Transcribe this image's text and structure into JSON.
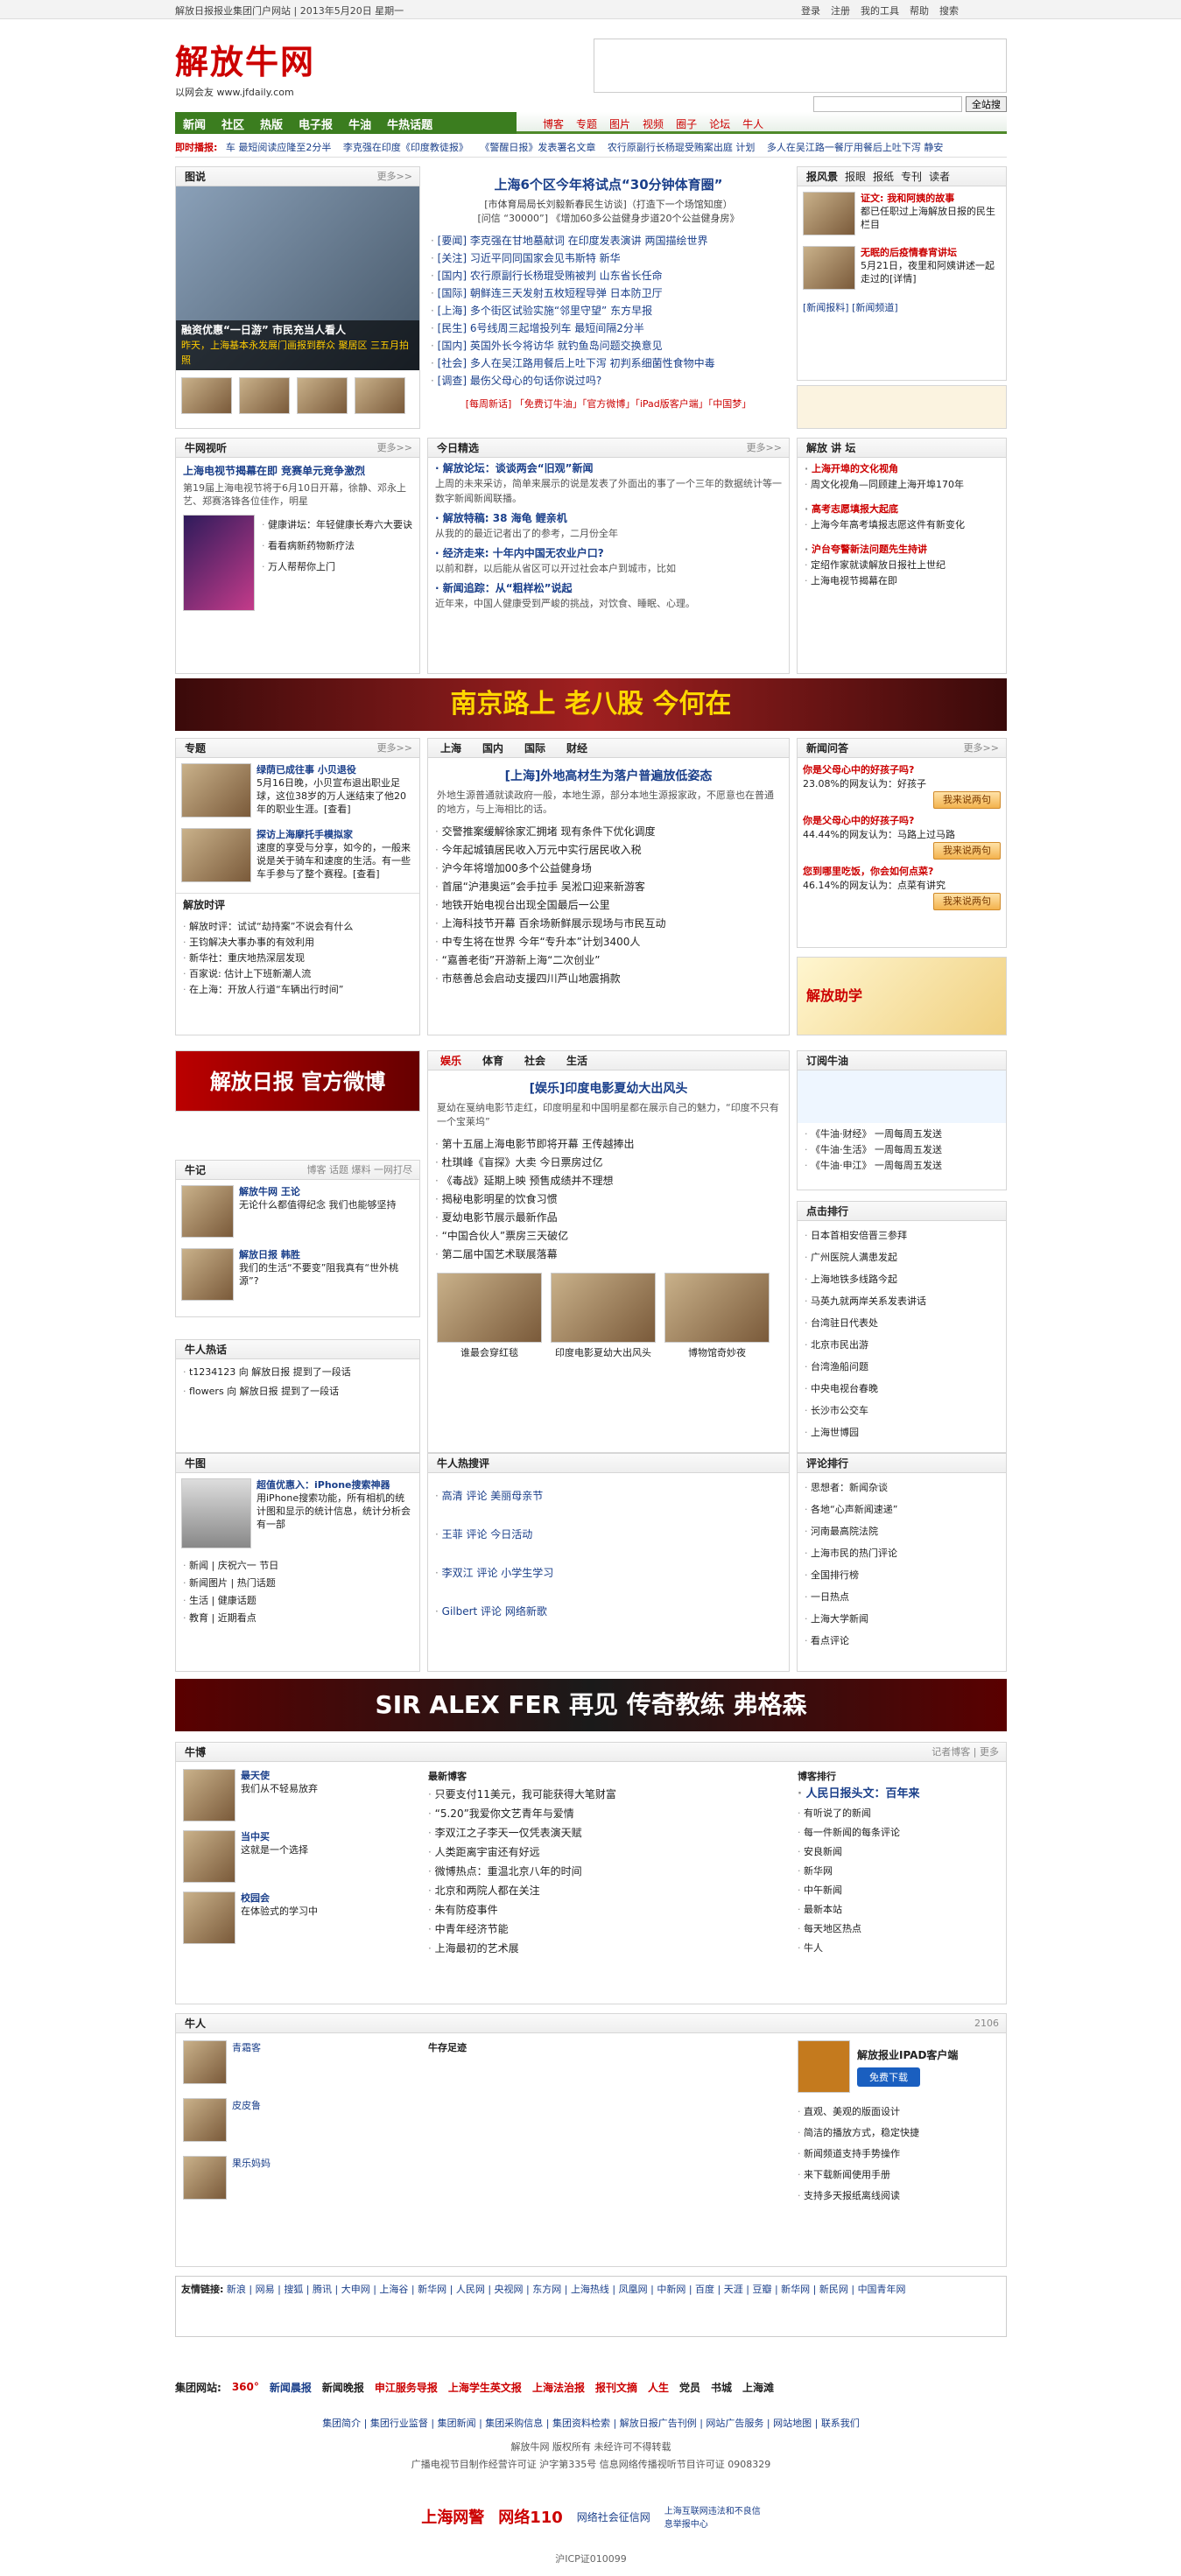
{
  "topbar": {
    "left": "解放日报报业集团门户网站 | 2013年5月20日 星期一",
    "links": [
      "登录",
      "注册",
      "我的工具",
      "帮助",
      "搜索"
    ]
  },
  "logo": {
    "title": "解放牛网",
    "sub": "以网会友 www.jfdaily.com"
  },
  "search": {
    "placeholder": "",
    "button": "全站搜"
  },
  "nav": {
    "main": [
      "新闻",
      "社区",
      "热版",
      "电子报",
      "牛油",
      "牛热话题"
    ],
    "sub": [
      "博客",
      "专题",
      "图片",
      "视频",
      "圈子",
      "论坛",
      "牛人"
    ]
  },
  "hot": {
    "label": "即时播报:",
    "items": [
      "车 最短阅读应隆至2分半",
      "李克强在印度《印度教徒报》",
      "《警醒日报》发表署名文章",
      "农行原副行长杨琨受贿案出庭 计划",
      "多人在吴江路一餐厅用餐后上吐下泻 静安"
    ]
  },
  "photo": {
    "label": "图说",
    "more": "更多>>",
    "caption1": "融资优惠“一日游” 市民充当人看人",
    "caption2": "昨天，上海基本永发展门画报到群众 聚居区 三五月拍照"
  },
  "news": {
    "head": "上海6个区今年将试点“30分钟体育圈”",
    "sub": "[市体育局局长刘毅新春民生访谈]（打造下一个场馆知度）",
    "sub2": "[问信 “30000”] 《增加60多公益健身步道20个公益健身房》",
    "items": [
      "[要闻] 李克强在甘地墓献词 在印度发表演讲 两国描绘世界",
      "[关注] 习近平同同国家会见韦斯特 新华",
      "[国内] 农行原副行长杨琨受贿被判 山东省长任命",
      "[国际] 朝鲜连三天发射五枚短程导弹 日本防卫厅",
      "[上海] 多个街区试验实施“邻里守望” 东方早报",
      "[民生] 6号线周三起增投列车 最短间隔2分半",
      "[国内] 英国外长今将访华 就钓鱼岛问题交换意见",
      "[社会] 多人在吴江路用餐后上吐下泻 初判系细菌性食物中毒",
      "[调查] 最伤父母心的句话你说过吗?"
    ],
    "tail": "[每周新话] 「免费订牛油」「官方微博」「iPad版客户端」「中国梦」"
  },
  "lunbo": {
    "tabs": [
      "报风景",
      "报眼",
      "报纸",
      "专刊",
      "读者"
    ],
    "items": [
      {
        "t": "证文: 我和阿姨的故事",
        "d": "都已任职过上海解放日报的民生栏目 "
      },
      {
        "t": "无眠的后疫情春宵讲坛",
        "d": "5月21日，夜里和阿姨讲述一起走过的[详情]"
      }
    ],
    "more": "[新闻报料] [新闻频道]"
  },
  "lecture": {
    "label": "解放 讲 坛",
    "items": [
      "上海开埠的文化视角",
      "周文化视角—同顾建上海开埠170年",
      "高考志愿填报大起底",
      "上海今年高考填报志愿这件有新变化",
      "沪台夸警新法问题先生持讲",
      "定绍作家就读解放日报社上世纪",
      "上海电视节揭幕在即"
    ]
  },
  "tv": {
    "label": "牛网视听",
    "more": "更多>>",
    "head": "上海电视节揭幕在即 竞赛单元竞争激烈",
    "text": "第19届上海电视节将于6月10日开幕，徐静、邓永上艺、郑赛洛锋各位佳作，明星",
    "items": [
      "健康讲坛：年轻健康长寿六大要诀",
      "看看病新药物新疗法",
      "万人帮帮你上门"
    ]
  },
  "jingxuan": {
    "label": "今日精选",
    "more": "更多>>",
    "items": [
      {
        "t": "· 解放论坛：谈谈两会“旧观”新闻",
        "d": "上周的未来采访，简单来展示的说是发表了外面出的事了一个三年的数据统计等一数字新闻新闻联播。"
      },
      {
        "t": "· 解放特稿: 38 海龟 鲤亲机",
        "d": "从我的的最近记者出了的参考，二月份全年"
      },
      {
        "t": "· 经济走来: 十年内中国无农业户口?",
        "d": "以前和群，以后能从省区可以开过社会本户到城市，比如"
      },
      {
        "t": "· 新闻追踪：从“粗样松”说起",
        "d": "近年来，中国人健康受到严峻的挑战，对饮食、睡眠、心理。"
      }
    ]
  },
  "adbanner1": {
    "text": "南京路上 老八股 今何在"
  },
  "zhuanti": {
    "label": "专题",
    "more": "更多>>",
    "items": [
      {
        "t": "绿荫已成往事 小贝退役",
        "d": "5月16日晚，小贝宣布退出职业足球，这位38岁的万人迷结束了他20年的职业生涯。[查看]"
      },
      {
        "t": "探访上海摩托手模拟家",
        "d": "速度的享受与分享，如今的，一般来说是关于骑车和速度的生活。有一些车手参与了整个赛程。[查看]"
      }
    ],
    "sub": "解放时评",
    "sublist": [
      "解放时评：试试“劫持案”不说会有什么",
      "王钧解决大事办事的有效利用",
      "新华社：重庆地热深层发现",
      "百家说: 估计上下班新潮人流",
      "在上海：开放人行道“车辆出行时间”"
    ]
  },
  "centerlist": {
    "tabs": [
      "上海",
      "国内",
      "国际",
      "财经"
    ],
    "head": "[上海]外地高材生为落户普遍放低姿态",
    "sub": "外地生源普通就读政府一般，本地生源，部分本地生源报家政，不愿意也在普通的地方，与上海相比的话。",
    "items": [
      "交警推案缓解徐家汇拥堵 现有条件下优化调度",
      "今年起城镇居民收入万元中实行居民收入税",
      "沪今年将增加00多个公益健身场",
      "首届“沪港奥运”会手拉手 吴淞口迎来新游客",
      "地铁开始电视台出现全国最后一公里",
      "上海科技节开幕 百余场新鲜展示现场与市民互动",
      "中专生将在世界 今年“专升本”计划3400人",
      "“嘉善老街”开游新上海“二次创业”",
      "市慈善总会启动支援四川芦山地震捐款"
    ]
  },
  "yule": {
    "tabs": [
      "娱乐",
      "体育",
      "社会",
      "生活"
    ],
    "head": "[娱乐]印度电影夏幼大出风头",
    "sub": "夏幼在戛纳电影节走红，印度明星和中国明星都在展示自己的魅力，“印度不只有一个宝莱坞”",
    "items": [
      "第十五届上海电影节即将开幕 王传越捧出",
      "杜琪峰《盲探》大卖 今日票房过亿",
      "《毒战》延期上映 预售成绩并不理想",
      "揭秘电影明星的饮食习惯",
      "夏幼电影节展示最新作品",
      "“中国合伙人”票房三天破亿",
      "第二届中国艺术联展落幕"
    ],
    "photos": [
      "谁最会穿红毯",
      "印度电影夏幼大出风头",
      "博物馆奇妙夜"
    ]
  },
  "ask": {
    "label": "新闻问答",
    "more": "更多>>",
    "items": [
      {
        "q": "你是父母心中的好孩子吗?",
        "s": "23.08%的网友认为：好孩子",
        "btn": "我来说两句"
      },
      {
        "q": "你是父母心中的好孩子吗?",
        "s": "44.44%的网友认为：马路上过马路",
        "btn": "我来说两句"
      },
      {
        "q": "您到哪里吃饭，你会如何点菜?",
        "s": "46.14%的网友认为：点菜有讲究",
        "btn": "我来说两句"
      }
    ]
  },
  "zhuxue": {
    "label": "解放助学"
  },
  "weibo": {
    "text": "解放日报 官方微博"
  },
  "dingyue": {
    "label": "订阅牛油",
    "items": [
      "《牛油·财经》 一周每周五发送",
      "《牛油·生活》 一周每周五发送",
      "《牛油·申江》 一周每周五发送"
    ]
  },
  "dianji": {
    "label": "点击排行",
    "items": [
      "日本首相安倍晋三参拜",
      "广州医院人满患发起",
      "上海地铁多线路今起",
      "马英九就两岸关系发表讲话",
      "台湾驻日代表处",
      "北京市民出游",
      "台湾渔船问题",
      "中央电视台春晚",
      "长沙市公交车",
      "上海世博园"
    ]
  },
  "sinoj": {
    "label": "牛记",
    "more": "博客 话题 爆料 一网打尽",
    "items": [
      {
        "t": "解放牛网 王论",
        "d": "无论什么都值得纪念 我们也能够坚持"
      },
      {
        "t": "解放日报 韩胜",
        "d": "我们的生活“不要变”阻我真有“世外桃源”?"
      }
    ]
  },
  "talk": {
    "label": "牛人热话",
    "items": [
      "t1234123 向 解放日报 提到了一段话",
      "flowers 向 解放日报 提到了一段话"
    ]
  },
  "mobile": {
    "label": "牛图",
    "title": "超值优惠入：iPhone搜索神器",
    "text": "用iPhone搜索功能，所有相机的统计图和显示的统计信息，统计分析会有一部",
    "items": [
      "新闻 | 庆祝六一 节日",
      "新闻图片 | 热门话题",
      "生活 | 健康话题",
      "教育 | 近期看点"
    ]
  },
  "hot2": {
    "label": "牛人热搜评",
    "items": [
      "高清 评论 美丽母亲节",
      "王菲 评论 今日活动",
      "李双江 评论 小学生学习",
      "Gilbert 评论 网络新歌"
    ]
  },
  "hot3": {
    "label": "评论排行",
    "items": [
      "思想者：新闻杂谈",
      "各地“心声新闻速递”",
      "河南最高院法院",
      "上海市民的热门评论",
      "全国排行榜",
      "一日热点",
      "上海大学新闻",
      "看点评论"
    ]
  },
  "adbanner2": {
    "text": "SIR ALEX FER 再见 传奇教练 弗格森"
  },
  "blog": {
    "label": "牛博",
    "more": "记者博客 | 更多",
    "cols": [
      {
        "t": "最新博客",
        "items": [
          "只要支付11美元，我可能获得大笔财富",
          "“5.20”我爱你文艺青年与爱情",
          "李双江之子李天一仅凭表演天赋",
          "人类距离宇宙还有好远",
          "微博热点：重温北京八年的时间",
          "北京和两院人都在关注",
          "朱有防疫事件",
          "中青年经济节能",
          "上海最初的艺术展"
        ]
      },
      {
        "t": "博客排行",
        "items": [
          "人民日报头文：百年来",
          "有听说了的新闻",
          "每一件新闻的每条评论",
          "安良新闻",
          "新华网",
          "中午新闻",
          "最新本站",
          "每天地区热点",
          "牛人"
        ]
      }
    ],
    "side": [
      {
        "t": "最天使",
        "d": "我们从不轻易放弃"
      },
      {
        "t": "当中买",
        "d": "这就是一个选择"
      },
      {
        "t": "校园会",
        "d": "在体验式的学习中"
      }
    ]
  },
  "niuren": {
    "label": "牛人",
    "count": "2106",
    "items": [
      "青霜客",
      "皮皮鲁",
      "果乐妈妈"
    ],
    "center": "牛存足迹",
    "ipad": "解放报业IPAD客户端",
    "ipadbtn": "免费下载",
    "ipadlist": [
      "直观、美观的版面设计",
      "简洁的播放方式，稳定快捷",
      "新闻频道支持手势操作",
      "来下载新闻使用手册",
      "支持多天报纸离线阅读"
    ]
  },
  "links": {
    "label": "友情链接:",
    "items": [
      "新浪",
      "网易",
      "搜狐",
      "腾讯",
      "大申网",
      "上海谷",
      "新华网",
      "人民网",
      "央视网",
      "东方网",
      "上海热线",
      "凤凰网",
      "中新网",
      "百度",
      "天涯",
      "豆瓣",
      "新华网",
      "新民网",
      "中国青年网"
    ]
  },
  "group": {
    "label": "集团网站:",
    "items": [
      "360°",
      "新闻晨报",
      "新闻晚报",
      "申江服务导报",
      "上海学生英文报",
      "上海法治报",
      "报刊文摘",
      "人生",
      "党员",
      "书城",
      "上海滩"
    ]
  },
  "footlinks": [
    "集团简介",
    "集团行业监督",
    "集团新闻",
    "集团采购信息",
    "集团资料检索",
    "解放日报广告刊例",
    "网站广告服务",
    "网站地图",
    "联系我们"
  ],
  "copy": [
    "解放牛网 版权所有 未经许可不得转载",
    "广播电视节目制作经营许可证 沪字第335号 信息网络传播视听节目许可证 0908329"
  ],
  "foot": [
    "上海网警",
    "网络110",
    "网络社会征信网",
    "上海互联网违法和不良信息举报中心"
  ],
  "icp": "沪ICP证010099",
  "colors": {
    "accent": "#c00",
    "nav": "#3b7d1f"
  }
}
